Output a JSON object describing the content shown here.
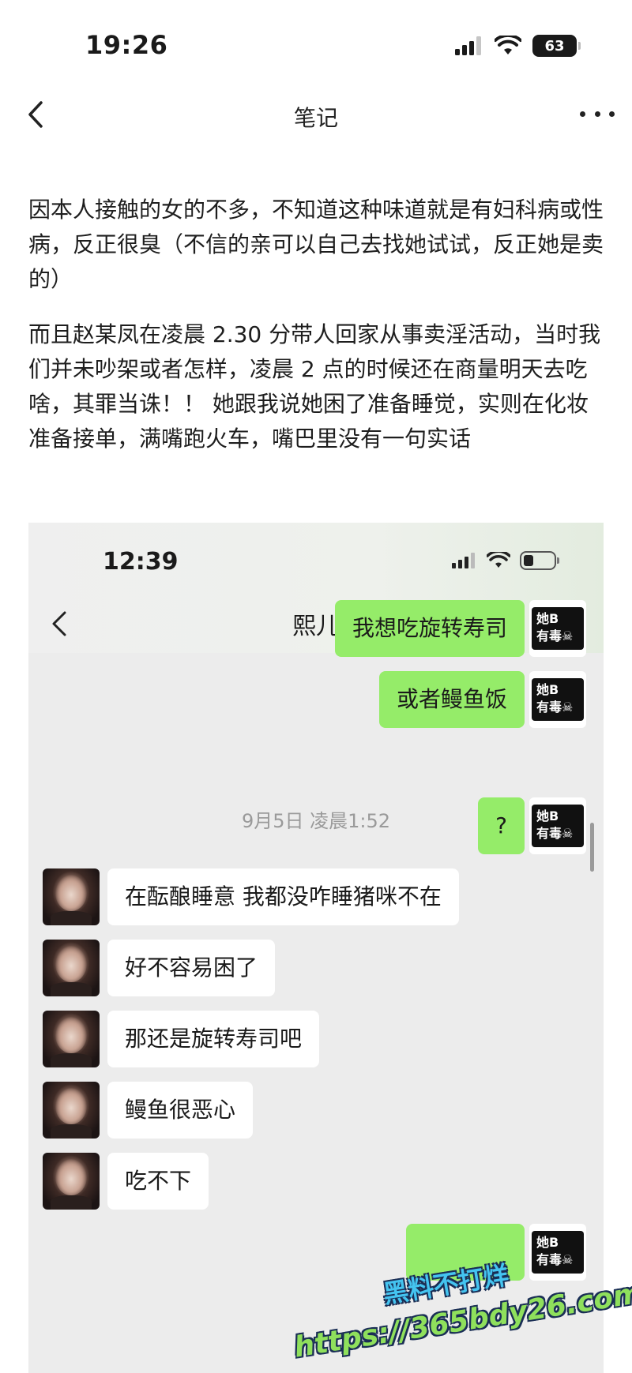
{
  "status_bar": {
    "time": "19:26",
    "battery": "63"
  },
  "nav": {
    "title": "笔记"
  },
  "note": {
    "paragraph_1": "因本人接触的女的不多，不知道这种味道就是有妇科病或性病，反正很臭（不信的亲可以自己去找她试试，反正她是卖的）",
    "paragraph_2": "而且赵某凤在凌晨 2.30 分带人回家从事卖淫活动，当时我们并未吵架或者怎样，凌晨 2 点的时候还在商量明天去吃啥，其罪当诛！！ 她跟我说她困了准备睡觉，实则在化妆准备接单，满嘴跑火车，嘴巴里没有一句实话"
  },
  "screenshot": {
    "status_time": "12:39",
    "contact_name": "熙儿",
    "my_avatar_text": {
      "line1": "她B",
      "line2": "有毒☠"
    },
    "timestamp": "9月5日 凌晨1:52",
    "messages": [
      {
        "from": "me",
        "text": "我想吃旋转寿司"
      },
      {
        "from": "me",
        "text": "或者鳗鱼饭"
      },
      {
        "from": "me",
        "text": "?"
      },
      {
        "from": "her",
        "text": "在酝酿睡意 我都没咋睡猪咪不在"
      },
      {
        "from": "her",
        "text": "好不容易困了"
      },
      {
        "from": "her",
        "text": "那还是旋转寿司吧"
      },
      {
        "from": "her",
        "text": "鳗鱼很恶心"
      },
      {
        "from": "her",
        "text": "吃不下"
      },
      {
        "from": "me",
        "text": ""
      }
    ]
  },
  "watermark": {
    "line1": "黑料不打烊",
    "line2": "https://365bdy26.com"
  },
  "colors": {
    "my_bubble": "#95ec69",
    "her_bubble": "#ffffff",
    "chat_bg": "#ececec"
  }
}
